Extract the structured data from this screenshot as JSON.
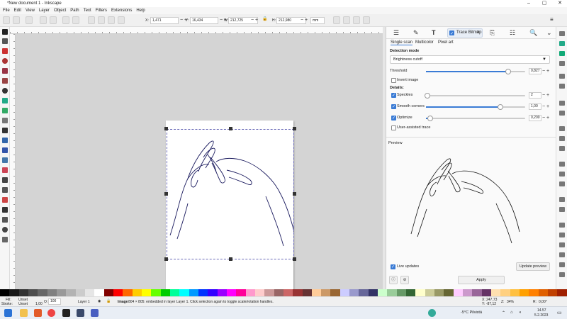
{
  "app": {
    "title": "*New document 1 - Inkscape"
  },
  "menu": [
    "File",
    "Edit",
    "View",
    "Layer",
    "Object",
    "Path",
    "Text",
    "Filters",
    "Extensions",
    "Help"
  ],
  "toolbar": {
    "x_label": "X:",
    "x_value": "1,471",
    "y_label": "Y:",
    "y_value": "16,434",
    "w_label": "W:",
    "w_value": "212,725",
    "h_label": "H:",
    "h_value": "212,980",
    "unit": "mm"
  },
  "panel": {
    "trace_tab": "Trace Bitmap",
    "subtabs": [
      "Single scan",
      "Multicolor",
      "Pixel art"
    ],
    "detection_mode_label": "Detection mode",
    "detection_mode_value": "Brightness cutoff",
    "threshold_label": "Threshold",
    "threshold_value": "0,827",
    "threshold_fraction": 0.827,
    "invert_label": "Invert image",
    "invert_checked": false,
    "details_label": "Details:",
    "speckles_label": "Speckles",
    "speckles_value": "2",
    "speckles_checked": true,
    "smooth_label": "Smooth corners",
    "smooth_value": "1,00",
    "smooth_fraction": 0.75,
    "smooth_checked": true,
    "optimize_label": "Optimize",
    "optimize_value": "0,200",
    "optimize_fraction": 0.04,
    "optimize_checked": true,
    "user_assisted_label": "User-assisted trace",
    "user_assisted_checked": false,
    "preview_label": "Preview",
    "live_updates_label": "Live updates",
    "live_updates_checked": true,
    "update_preview_label": "Update preview",
    "apply_label": "Apply"
  },
  "status": {
    "fill_label": "Fill:",
    "fill_value": "Unset",
    "stroke_label": "Stroke:",
    "stroke_value": "Unset",
    "stroke_width": "1,00",
    "opacity_label": "O:",
    "opacity_value": "100",
    "layer": "Layer 1",
    "message_bold": "Image",
    "message": " 804 × 805: embedded in layer Layer 1. Click selection again to toggle scale/rotation handles.",
    "x_readout": "X: 247,73",
    "y_readout": "Y: -87,12",
    "zoom_label": "Z:",
    "zoom_value": "34%",
    "rot_label": "R:",
    "rot_value": "0,00°"
  },
  "taskbar": {
    "weather": "-5°C Pilvistä",
    "time": "14.57",
    "date": "5.2.2023"
  },
  "colors": {
    "accent": "#3a7bd5",
    "palette": [
      "#000000",
      "#1a1a1a",
      "#333333",
      "#4d4d4d",
      "#666666",
      "#808080",
      "#999999",
      "#b3b3b3",
      "#cccccc",
      "#e6e6e6",
      "#ffffff",
      "#800000",
      "#ff0000",
      "#ff6600",
      "#ffcc00",
      "#ffff00",
      "#66ff00",
      "#00cc00",
      "#00ff99",
      "#00ffff",
      "#0099ff",
      "#0033ff",
      "#3300ff",
      "#9900ff",
      "#ff00ff",
      "#ff0099",
      "#ff99cc",
      "#ffcccc",
      "#cc9999",
      "#996666",
      "#cc6666",
      "#993333",
      "#663333",
      "#ffcc99",
      "#cc9966",
      "#996633",
      "#ccccff",
      "#9999cc",
      "#666699",
      "#333366",
      "#ccffcc",
      "#99cc99",
      "#669966",
      "#336633",
      "#ffffcc",
      "#cccc99",
      "#999966",
      "#666633",
      "#ffccff",
      "#cc99cc",
      "#996699",
      "#663366",
      "#ffe0b0",
      "#ffd080",
      "#ffc040",
      "#ffa000",
      "#ff8000",
      "#e06000",
      "#c04000",
      "#a02000"
    ]
  }
}
